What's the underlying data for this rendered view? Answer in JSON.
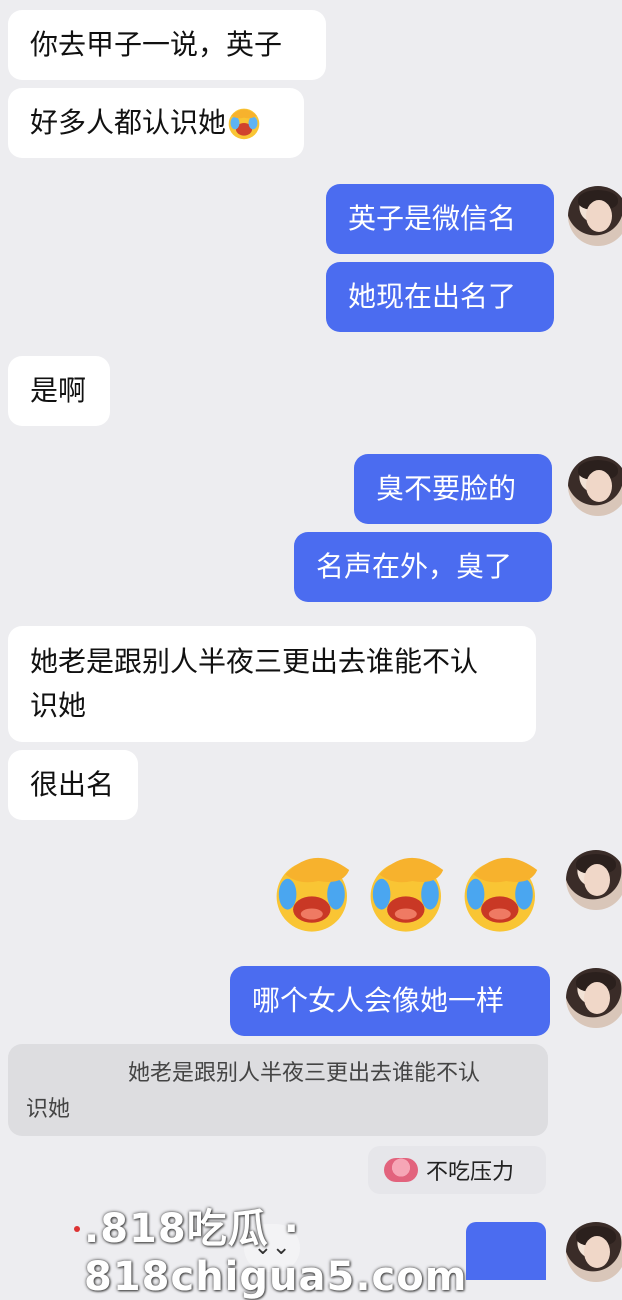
{
  "messages": [
    {
      "side": "left",
      "text": "你去甲子一说，英子"
    },
    {
      "side": "left",
      "text": "好多人都认识她"
    },
    {
      "side": "right",
      "text": "英子是微信名"
    },
    {
      "side": "right",
      "text": "她现在出名了"
    },
    {
      "side": "left",
      "text": "是啊"
    },
    {
      "side": "right",
      "text": "臭不要脸的"
    },
    {
      "side": "right",
      "text": "名声在外，臭了"
    },
    {
      "side": "left",
      "text_line1": "她老是跟别人半夜三更出去谁能不认",
      "text_line2": "识她"
    },
    {
      "side": "left",
      "text": "很出名"
    },
    {
      "side": "right",
      "text": "哪个女人会像她一样"
    }
  ],
  "inline_emoji": "facepalm-laugh-emoji",
  "reaction_emojis": [
    "facepalm-laugh-emoji",
    "facepalm-laugh-emoji",
    "facepalm-laugh-emoji"
  ],
  "quoted_reply": {
    "line1": "她老是跟别人半夜三更出去谁能不认",
    "line2": "识她"
  },
  "sticker_label": "不吃压力",
  "scroll_down_icon": "double-chevron-down-icon",
  "watermark": ".818吃瓜 · 818chigua5.com",
  "colors": {
    "background": "#ededf0",
    "incoming_bubble": "#ffffff",
    "outgoing_bubble": "#4b6cf0",
    "text_dark": "#111111",
    "text_light": "#ffffff"
  }
}
